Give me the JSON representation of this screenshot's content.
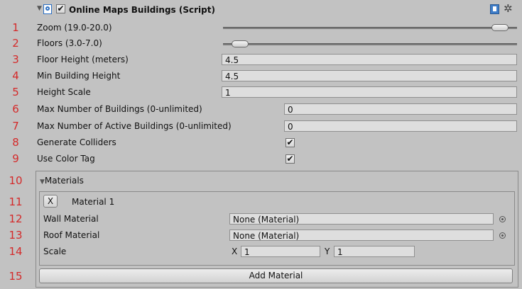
{
  "header": {
    "title": "Online Maps Buildings (Script)",
    "enabled": true
  },
  "rows": [
    {
      "num": "1",
      "label": "Zoom (19.0-20.0)"
    },
    {
      "num": "2",
      "label": "Floors (3.0-7.0)"
    },
    {
      "num": "3",
      "label": "Floor Height (meters)",
      "value": "4.5"
    },
    {
      "num": "4",
      "label": "Min Building Height",
      "value": "4.5"
    },
    {
      "num": "5",
      "label": "Height Scale",
      "value": "1"
    },
    {
      "num": "6",
      "label": "Max Number of Buildings (0-unlimited)",
      "value": "0"
    },
    {
      "num": "7",
      "label": "Max Number of Active Buildings (0-unlimited)",
      "value": "0"
    },
    {
      "num": "8",
      "label": "Generate Colliders",
      "checked": true
    },
    {
      "num": "9",
      "label": "Use Color Tag",
      "checked": true
    },
    {
      "num": "10"
    },
    {
      "num": "11"
    },
    {
      "num": "12"
    },
    {
      "num": "13"
    },
    {
      "num": "14"
    },
    {
      "num": "15"
    }
  ],
  "sliders": {
    "zoom_level": 0.97,
    "floors_level": 0.03
  },
  "check_glyph": "✔",
  "materials": {
    "foldout_label": "Materials",
    "remove_label": "X",
    "item_title": "Material 1",
    "wall_label": "Wall Material",
    "wall_value": "None (Material)",
    "roof_label": "Roof Material",
    "roof_value": "None (Material)",
    "scale_label": "Scale",
    "scale_x_label": "X",
    "scale_x": "1",
    "scale_y_label": "Y",
    "scale_y": "1",
    "add_button": "Add Material"
  },
  "icons": {
    "foldout": "foldout-triangle-icon",
    "script": "script-icon",
    "help": "help-book-icon",
    "settings": "gear-icon",
    "object_picker": "object-picker-icon"
  }
}
